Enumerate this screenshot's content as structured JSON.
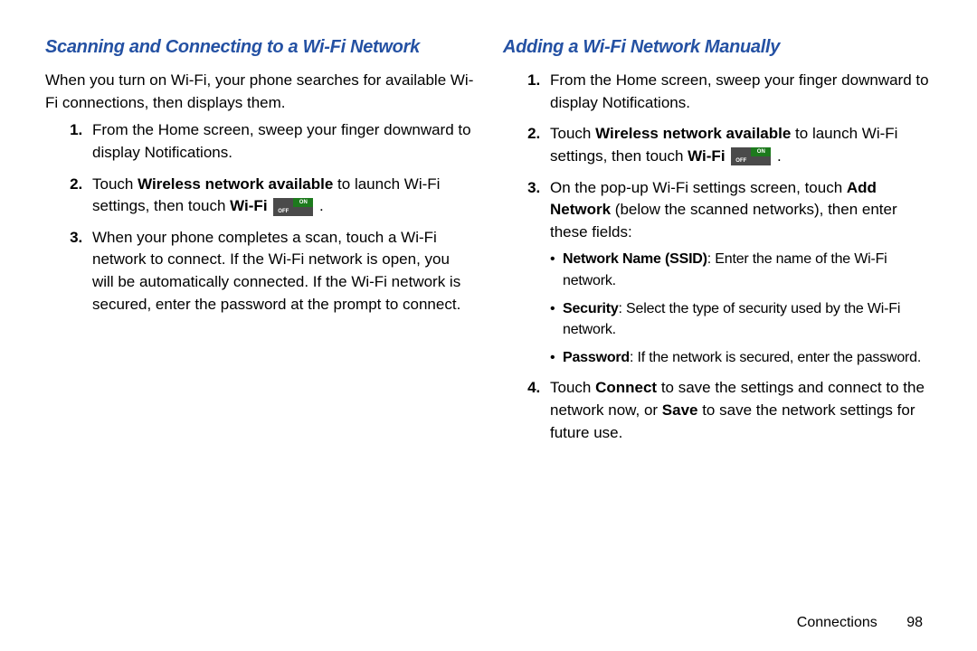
{
  "footer": {
    "section": "Connections",
    "page": "98"
  },
  "toggle": {
    "on": "ON",
    "off": "OFF"
  },
  "left": {
    "heading": "Scanning and Connecting to a Wi-Fi Network",
    "intro": "When you turn on Wi-Fi, your phone searches for available Wi-Fi connections, then displays them.",
    "s1": "From the Home screen, sweep your finger downward to display Notifications.",
    "s2a": "Touch ",
    "s2b": "Wireless network available",
    "s2c": " to launch Wi-Fi settings, then touch ",
    "s2d": "Wi-Fi",
    "s2e": " .",
    "s3": "When your phone completes a scan, touch a Wi-Fi network to connect. If the Wi-Fi network is open, you will be automatically connected. If the Wi-Fi network is secured, enter the password at the prompt to connect."
  },
  "right": {
    "heading": "Adding a Wi-Fi Network Manually",
    "s1": "From the Home screen, sweep your finger downward to display Notifications.",
    "s2a": "Touch ",
    "s2b": "Wireless network available",
    "s2c": " to launch Wi-Fi settings, then touch ",
    "s2d": "Wi-Fi",
    "s2e": " .",
    "s3a": "On the pop-up Wi-Fi settings screen, touch ",
    "s3b": "Add Network",
    "s3c": " (below the scanned networks), then enter these fields:",
    "b1a": "Network Name (SSID)",
    "b1b": ": Enter the name of the Wi-Fi network.",
    "b2a": "Security",
    "b2b": ": Select the type of security used by the Wi-Fi network.",
    "b3a": "Password",
    "b3b": ": If the network is secured, enter the password.",
    "s4a": "Touch ",
    "s4b": "Connect",
    "s4c": " to save the settings and connect to the network now, or ",
    "s4d": "Save",
    "s4e": " to save the network settings for future use."
  }
}
